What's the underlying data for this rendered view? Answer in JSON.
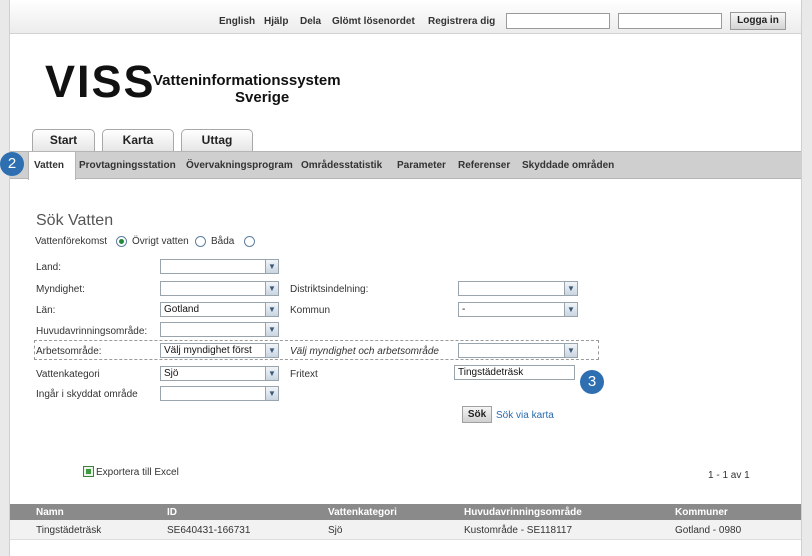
{
  "topbar": {
    "links": [
      "English",
      "Hjälp",
      "Dela",
      "Glömt lösenordet",
      "Registrera dig"
    ],
    "login_label": "Logga in"
  },
  "logo": {
    "name": "VISS",
    "subtitle_line1": "Vatteninformationssystem",
    "subtitle_line2": "Sverige"
  },
  "main_tabs": [
    "Start",
    "Karta",
    "Uttag"
  ],
  "sub_nav": {
    "items": [
      "Vatten",
      "Provtagningsstation",
      "Övervakningsprogram",
      "Områdesstatistik",
      "Parameter",
      "Referenser",
      "Skyddade områden"
    ],
    "active": "Vatten"
  },
  "badges": [
    "2",
    "3"
  ],
  "search": {
    "title": "Sök Vatten",
    "radio_options": [
      "Vattenförekomst",
      "Övrigt vatten",
      "Båda"
    ],
    "radio_selected": "Vattenförekomst",
    "fields": {
      "land": {
        "label": "Land:",
        "value": ""
      },
      "myndighet": {
        "label": "Myndighet:",
        "value": ""
      },
      "distrikt": {
        "label": "Distriktsindelning:",
        "value": ""
      },
      "lan": {
        "label": "Län:",
        "value": "Gotland"
      },
      "kommun": {
        "label": "Kommun",
        "value": "-"
      },
      "huvud": {
        "label": "Huvudavrinningsområde:",
        "value": ""
      },
      "arbets": {
        "label": "Arbetsområde:",
        "value": "Välj myndighet först"
      },
      "arbets_hint": {
        "label": "Välj myndighet och arbetsområde",
        "value": ""
      },
      "vattenkat": {
        "label": "Vattenkategori",
        "value": "Sjö"
      },
      "fritext": {
        "label": "Fritext",
        "value": "Tingstädeträsk"
      },
      "skyddat": {
        "label": "Ingår i skyddat område",
        "value": ""
      }
    },
    "search_button": "Sök",
    "map_link": "Sök via karta"
  },
  "export_label": "Exportera till Excel",
  "pager": "1 - 1  av 1",
  "results": {
    "columns": [
      "Namn",
      "ID",
      "Vattenkategori",
      "Huvudavrinningsområde",
      "Kommuner"
    ],
    "rows": [
      [
        "Tingstädeträsk",
        "SE640431-166731",
        "Sjö",
        "Kustområde - SE118117",
        "Gotland - 0980"
      ]
    ]
  },
  "colors": {
    "badge": "#2d6fb1",
    "subnav_bg": "#cfcfcf",
    "table_header": "#8a8a8a",
    "link": "#2a6bb0"
  }
}
